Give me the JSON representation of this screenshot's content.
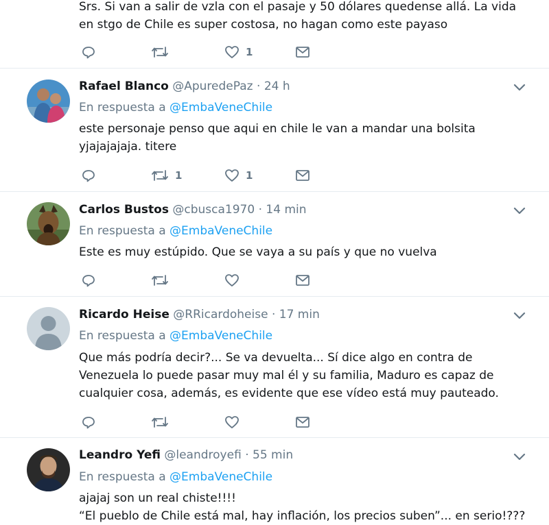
{
  "tweets": [
    {
      "text_lines": [
        "Srs. Si van a salir de vzla con el pasaje y 50 dólares quedense allá. La vida",
        "en stgo de Chile es super costosa, no hagan como este payaso"
      ],
      "retweets": "",
      "likes": "1"
    },
    {
      "name": "Rafael Blanco",
      "handle": "@ApuredePaz",
      "sep": "·",
      "time": "24 h",
      "reply_prefix": "En respuesta a",
      "reply_to": "@EmbaVeneChile",
      "text_lines": [
        "este personaje penso que aqui en chile le van a mandar una bolsita",
        "yjajajajaja. titere"
      ],
      "retweets": "1",
      "likes": "1"
    },
    {
      "name": "Carlos Bustos",
      "handle": "@cbusca1970",
      "sep": "·",
      "time": "14 min",
      "reply_prefix": "En respuesta a",
      "reply_to": "@EmbaVeneChile",
      "text_lines": [
        "Este es muy estúpido. Que se vaya a su país y que no vuelva"
      ],
      "retweets": "",
      "likes": ""
    },
    {
      "name": "Ricardo Heise",
      "handle": "@RRicardoheise",
      "sep": "·",
      "time": "17 min",
      "reply_prefix": "En respuesta a",
      "reply_to": "@EmbaVeneChile",
      "text_lines": [
        "Que más podría decir?... Se va devuelta... Sí dice algo en contra de",
        "Venezuela lo puede pasar muy mal él y su familia, Maduro es capaz de",
        "cualquier cosa, además, es evidente que ese vídeo está muy pauteado."
      ],
      "retweets": "",
      "likes": ""
    },
    {
      "name": "Leandro Yefi",
      "handle": "@leandroyefi",
      "sep": "·",
      "time": "55 min",
      "reply_prefix": "En respuesta a",
      "reply_to": "@EmbaVeneChile",
      "text_lines": [
        "ajajaj son un real chiste!!!!",
        "“El pueblo de Chile está mal, hay inflación, los precios suben”... en serio!???"
      ],
      "retweets": "",
      "likes": ""
    }
  ],
  "colors": {
    "link": "#1da1f2",
    "muted": "#657786",
    "text": "#14171a",
    "border": "#e6ecf0"
  },
  "icons": [
    "reply-icon",
    "retweet-icon",
    "like-icon",
    "direct-message-icon",
    "chevron-down-icon"
  ]
}
